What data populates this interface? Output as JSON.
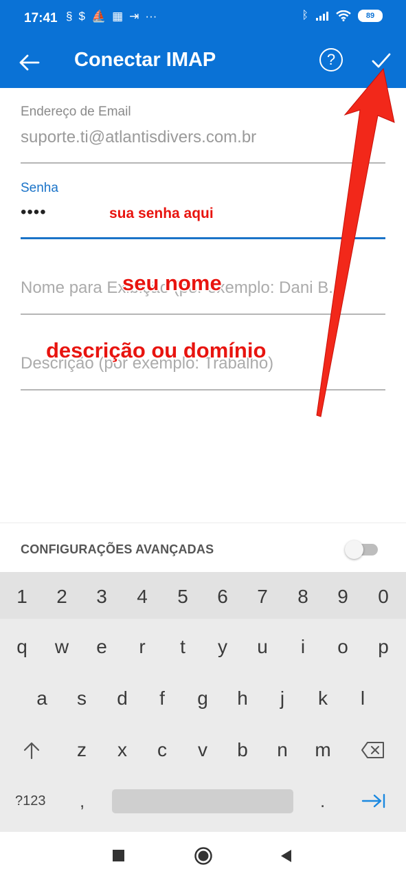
{
  "status_bar": {
    "time": "17:41",
    "left_icons": [
      "nfc-icon",
      "dollar-icon",
      "boat-icon",
      "qr-icon",
      "share-icon",
      "more-notifications-icon"
    ],
    "right_icons": [
      "bluetooth-icon",
      "signal-icon",
      "wifi-icon"
    ],
    "battery": "89"
  },
  "app_bar": {
    "title": "Conectar IMAP",
    "back_icon": "arrow-left-icon",
    "help_icon": "question-circle-icon",
    "confirm_icon": "checkmark-icon",
    "color": "#0a72d6"
  },
  "form": {
    "email": {
      "label": "Endereço de Email",
      "value": "suporte.ti@atlantisdivers.com.br"
    },
    "password": {
      "label": "Senha",
      "value": "••••"
    },
    "display_name": {
      "placeholder": "Nome para Exibição (por exemplo: Dani B..."
    },
    "description": {
      "placeholder": "Descrição (por exemplo: Trabalho)"
    }
  },
  "annotations": {
    "password_hint": "sua senha aqui",
    "name_hint": "seu nome",
    "description_hint": "descrição ou domínio",
    "color": "#e8140f"
  },
  "advanced": {
    "label": "CONFIGURAÇÕES AVANÇADAS",
    "toggle_on": false
  },
  "keyboard": {
    "numbers": [
      "1",
      "2",
      "3",
      "4",
      "5",
      "6",
      "7",
      "8",
      "9",
      "0"
    ],
    "row1": [
      "q",
      "w",
      "e",
      "r",
      "t",
      "y",
      "u",
      "i",
      "o",
      "p"
    ],
    "row2": [
      "a",
      "s",
      "d",
      "f",
      "g",
      "h",
      "j",
      "k",
      "l"
    ],
    "row3": [
      "z",
      "x",
      "c",
      "v",
      "b",
      "n",
      "m"
    ],
    "symbols_key": "?123",
    "comma": ",",
    "period": ".",
    "shift_icon": "shift-arrow-icon",
    "backspace_icon": "backspace-icon",
    "next_icon": "tab-next-icon"
  },
  "nav_bar": {
    "icons": [
      "recents-square-icon",
      "home-circle-icon",
      "back-triangle-icon"
    ]
  }
}
